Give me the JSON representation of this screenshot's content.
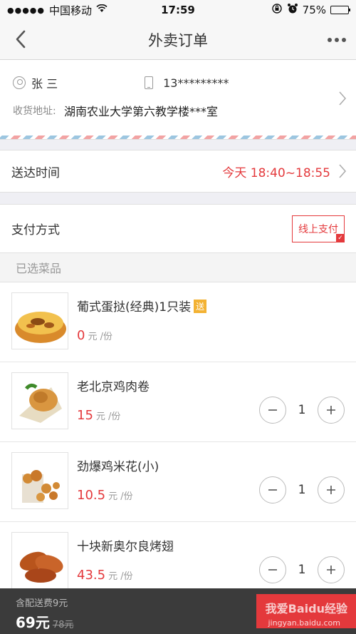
{
  "status_bar": {
    "signal": "●●●●●",
    "carrier": "中国移动",
    "time": "17:59",
    "battery": "75%",
    "battery_level": 0.75,
    "icons": [
      "wifi-icon",
      "rotation-lock-icon",
      "alarm-icon",
      "battery-icon"
    ]
  },
  "nav": {
    "title": "外卖订单",
    "back_icon": "chevron-left-icon",
    "more_icon": "more-dots-icon"
  },
  "address": {
    "name": "张 三",
    "phone": "13*********",
    "label": "收货地址:",
    "value": "湖南农业大学第六教学楼***室"
  },
  "delivery": {
    "label": "送达时间",
    "value": "今天 18:40~18:55"
  },
  "payment": {
    "label": "支付方式",
    "option": "线上支付"
  },
  "selected": {
    "header": "已选菜品",
    "items": [
      {
        "name": "葡式蛋挞(经典)1只装",
        "badge": "送",
        "price": "0",
        "unit": "元 /份",
        "qty": "",
        "image": "egg-tart-image"
      },
      {
        "name": "老北京鸡肉卷",
        "badge": "",
        "price": "15",
        "unit": "元 /份",
        "qty": "1",
        "image": "chicken-wrap-image"
      },
      {
        "name": "劲爆鸡米花(小)",
        "badge": "",
        "price": "10.5",
        "unit": "元 /份",
        "qty": "1",
        "image": "popcorn-chicken-image"
      },
      {
        "name": "十块新奥尔良烤翅",
        "badge": "",
        "price": "43.5",
        "unit": "元 /份",
        "qty": "1",
        "image": "grilled-wings-image"
      }
    ]
  },
  "bottom": {
    "fee": "含配送费9元",
    "total": "69元",
    "original": "78元",
    "watermark": "我爱Baidu经验",
    "watermark_url": "jingyan.baidu.com"
  },
  "colors": {
    "accent": "#e4393c",
    "gift_badge": "#f3b233",
    "bottom_bar": "#3b3b3b"
  }
}
